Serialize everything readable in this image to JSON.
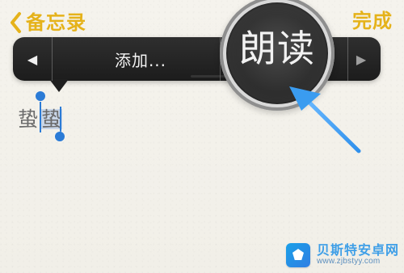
{
  "topbar": {
    "back_label": "备忘录",
    "done_label": "完成"
  },
  "menu": {
    "prev_icon": "◀",
    "add_label": "添加...",
    "speak_label": "朗读",
    "next_icon": "▶"
  },
  "editor": {
    "text_before": "蛰",
    "selected_text": "蛰"
  },
  "watermark": {
    "title": "贝斯特安卓网",
    "url": "www.zjbstyy.com"
  },
  "colors": {
    "accent": "#e5b21a",
    "selection": "#2b7bd6",
    "arrow": "#3a9cf0"
  }
}
